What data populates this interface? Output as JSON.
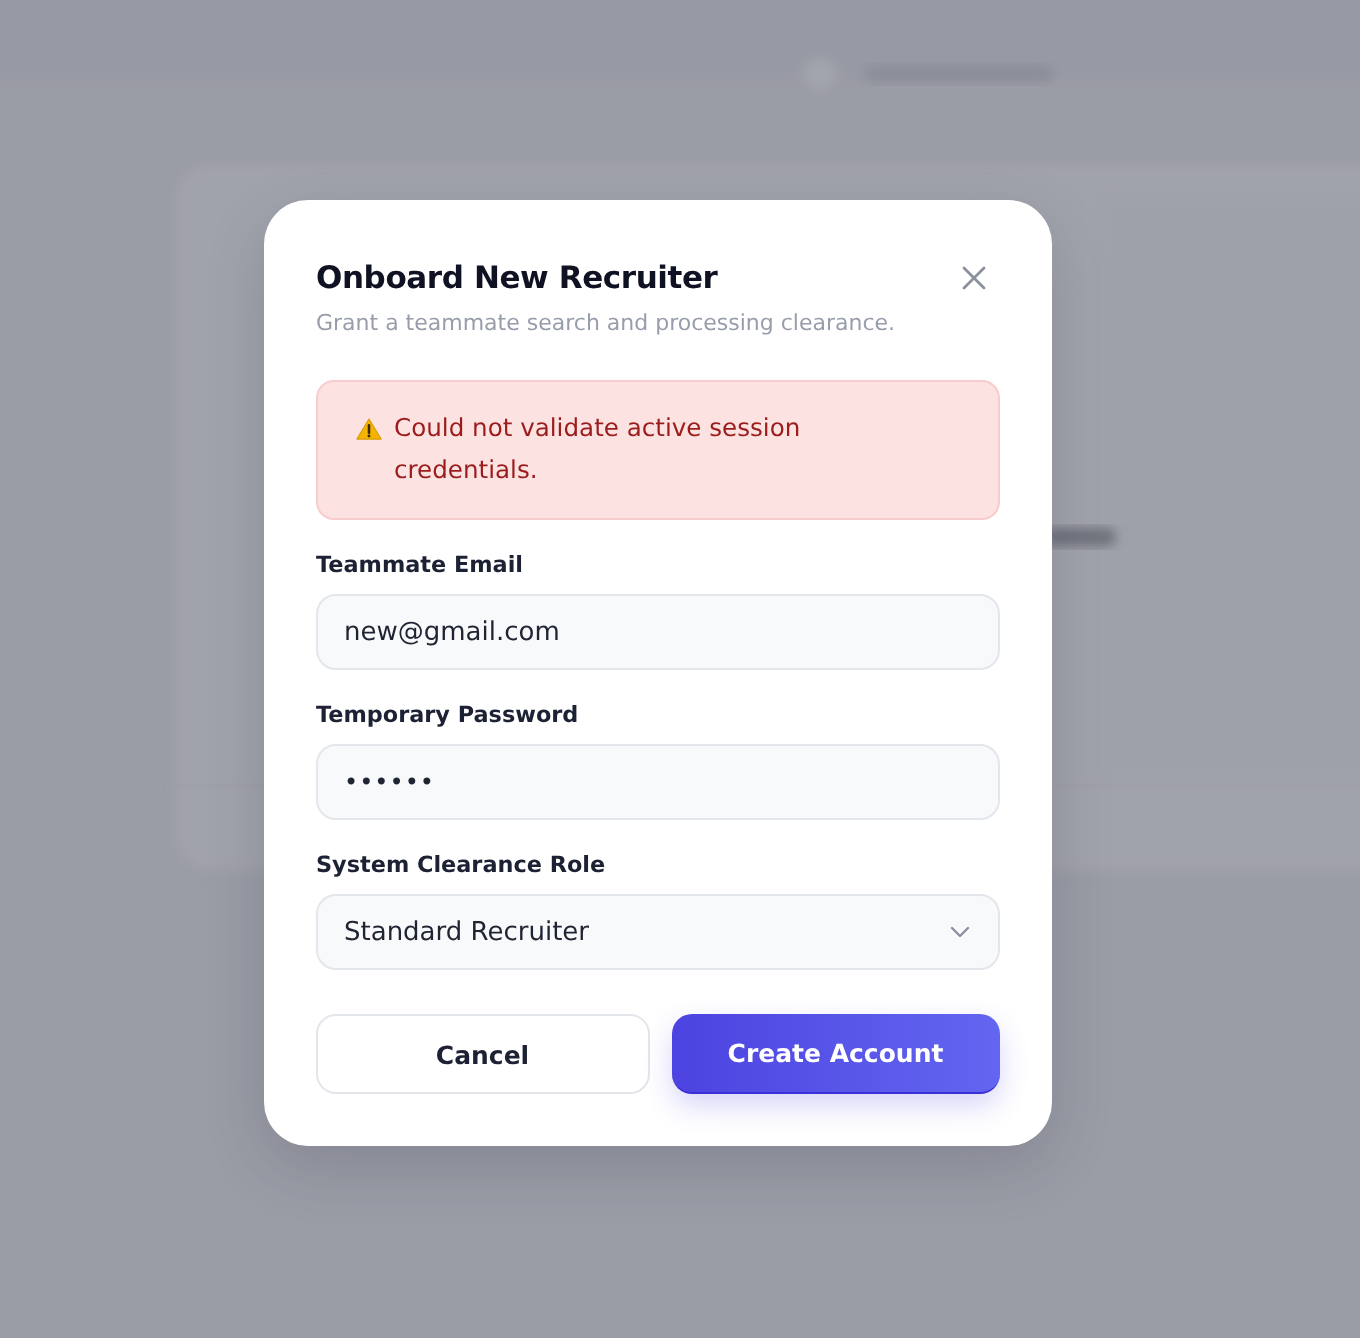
{
  "dialog": {
    "title": "Onboard New Recruiter",
    "subtitle": "Grant a teammate search and processing clearance.",
    "alert": {
      "kind": "error",
      "text": "Could not validate active session credentials."
    },
    "fields": [
      {
        "kind": "text",
        "label": "Teammate Email",
        "value": "new@gmail.com"
      },
      {
        "kind": "password",
        "label": "Temporary Password",
        "value": "••••••"
      },
      {
        "kind": "select",
        "label": "System Clearance Role",
        "value": "Standard Recruiter"
      }
    ],
    "buttons": [
      {
        "kind": "secondary",
        "label": "Cancel"
      },
      {
        "kind": "primary",
        "label": "Create Account"
      }
    ]
  }
}
